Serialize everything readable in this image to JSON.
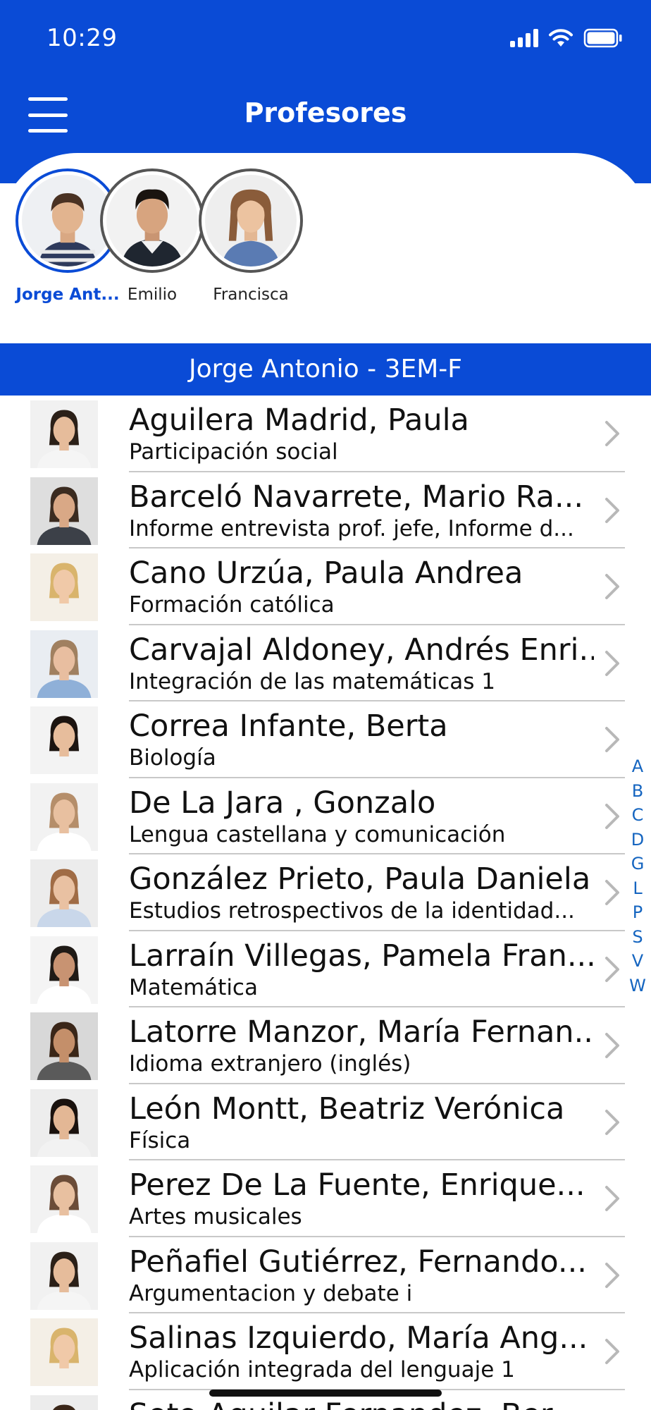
{
  "status_bar": {
    "time": "10:29"
  },
  "header": {
    "title": "Profesores"
  },
  "students": [
    {
      "name": "Jorge Ant...",
      "selected": true
    },
    {
      "name": "Emilio",
      "selected": false
    },
    {
      "name": "Francisca",
      "selected": false
    }
  ],
  "section": {
    "title": "Jorge Antonio - 3EM-F"
  },
  "teachers": [
    {
      "name": "Aguilera Madrid, Paula",
      "subject": "Participación social"
    },
    {
      "name": "Barceló Navarrete, Mario Ra...",
      "subject": "Informe entrevista prof. jefe, Informe d..."
    },
    {
      "name": "Cano Urzúa, Paula Andrea",
      "subject": "Formación católica"
    },
    {
      "name": "Carvajal Aldoney, Andrés Enri...",
      "subject": "Integración de las matemáticas 1"
    },
    {
      "name": "Correa Infante, Berta",
      "subject": "Biología"
    },
    {
      "name": "De La Jara , Gonzalo",
      "subject": "Lengua castellana y comunicación"
    },
    {
      "name": "González Prieto, Paula Daniela",
      "subject": "Estudios retrospectivos de la identidad..."
    },
    {
      "name": "Larraín Villegas, Pamela Fran...",
      "subject": "Matemática"
    },
    {
      "name": "Latorre Manzor, María Fernan...",
      "subject": "Idioma extranjero (inglés)"
    },
    {
      "name": "León Montt, Beatriz Verónica",
      "subject": "Física"
    },
    {
      "name": "Perez De La Fuente, Enrique...",
      "subject": "Artes musicales"
    },
    {
      "name": "Peñafiel Gutiérrez, Fernando...",
      "subject": "Argumentacion y debate i"
    },
    {
      "name": "Salinas Izquierdo, María Ang...",
      "subject": "Aplicación integrada del lenguaje 1"
    },
    {
      "name": "Soto-Aguilar Fernandez, Ber...",
      "subject": ""
    }
  ],
  "alphabet_index": [
    "A",
    "B",
    "C",
    "D",
    "G",
    "L",
    "P",
    "S",
    "V",
    "W"
  ],
  "colors": {
    "primary": "#0a4bd6",
    "index_letter": "#1565c0"
  }
}
